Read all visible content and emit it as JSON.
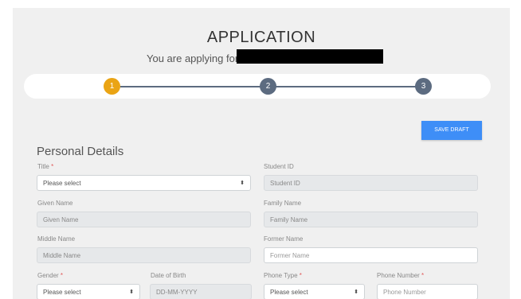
{
  "header": {
    "title": "APPLICATION",
    "subtitle": "You are applying for"
  },
  "stepper": {
    "steps": [
      {
        "label": "1",
        "state": "active"
      },
      {
        "label": "2",
        "state": "todo"
      },
      {
        "label": "3",
        "state": "todo"
      }
    ],
    "colors": {
      "active": "#eaa414",
      "todo": "#5c6b80"
    }
  },
  "toolbar": {
    "save_draft_label": "SAVE DRAFT"
  },
  "section_title": "Personal Details",
  "form": {
    "title": {
      "label": "Title",
      "required": "*",
      "value": "Please select"
    },
    "student_id": {
      "label": "Student ID",
      "placeholder": "Student ID"
    },
    "given_name": {
      "label": "Given Name",
      "placeholder": "Given Name"
    },
    "family_name": {
      "label": "Family Name",
      "placeholder": "Family Name"
    },
    "middle_name": {
      "label": "Middle Name",
      "placeholder": "Middle Name"
    },
    "former_name": {
      "label": "Former Name",
      "placeholder": "Former Name"
    },
    "gender": {
      "label": "Gender",
      "required": "*",
      "value": "Please select"
    },
    "dob": {
      "label": "Date of Birth",
      "placeholder": "DD-MM-YYYY"
    },
    "phone_type": {
      "label": "Phone Type",
      "required": "*",
      "value": "Please select"
    },
    "phone_number": {
      "label": "Phone Number",
      "required": "*",
      "placeholder": "Phone Number"
    }
  },
  "icons": {
    "select_caret": "up-down-caret-icon",
    "caret_glyph": "⬍"
  },
  "colors": {
    "accent": "#3e8ef7",
    "required": "#e05a5a"
  }
}
